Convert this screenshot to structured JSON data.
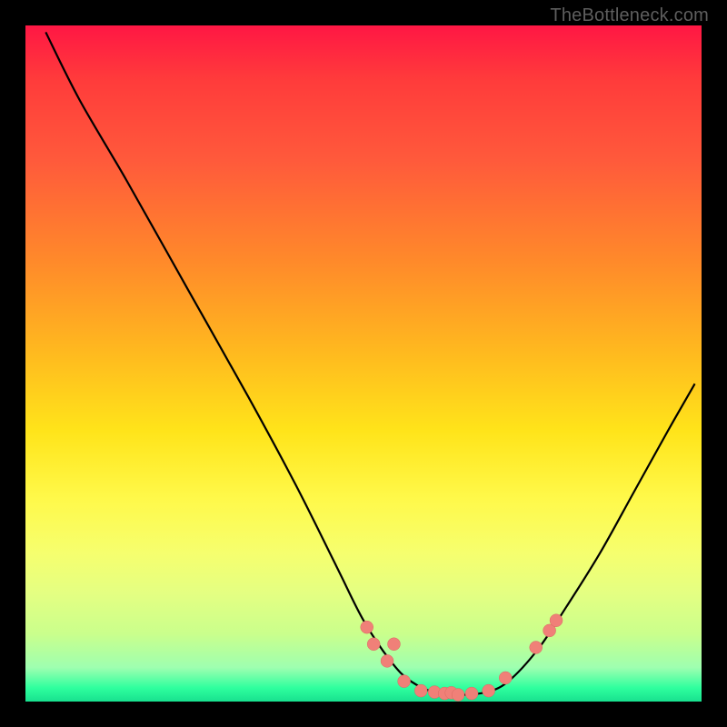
{
  "watermark": "TheBottleneck.com",
  "colors": {
    "curve_stroke": "#000000",
    "dot_fill": "#f08078",
    "dot_stroke": "#d86a62",
    "background_black": "#000000"
  },
  "chart_data": {
    "type": "line",
    "title": "",
    "xlabel": "",
    "ylabel": "",
    "xlim": [
      0,
      100
    ],
    "ylim": [
      0,
      100
    ],
    "left_curve": [
      {
        "x": 3,
        "y": 99
      },
      {
        "x": 8,
        "y": 89
      },
      {
        "x": 15,
        "y": 77
      },
      {
        "x": 24,
        "y": 61
      },
      {
        "x": 33,
        "y": 45
      },
      {
        "x": 40,
        "y": 32
      },
      {
        "x": 46,
        "y": 20
      },
      {
        "x": 50,
        "y": 12
      },
      {
        "x": 54,
        "y": 6
      },
      {
        "x": 57,
        "y": 3
      },
      {
        "x": 61,
        "y": 1.2
      },
      {
        "x": 65,
        "y": 1.0
      },
      {
        "x": 69,
        "y": 1.6
      },
      {
        "x": 72,
        "y": 3.5
      }
    ],
    "right_curve": [
      {
        "x": 72,
        "y": 3.5
      },
      {
        "x": 76,
        "y": 8
      },
      {
        "x": 80,
        "y": 14
      },
      {
        "x": 85,
        "y": 22
      },
      {
        "x": 90,
        "y": 31
      },
      {
        "x": 95,
        "y": 40
      },
      {
        "x": 99,
        "y": 47
      }
    ],
    "scatter_points": [
      {
        "x": 50.5,
        "y": 11.0
      },
      {
        "x": 51.5,
        "y": 8.5
      },
      {
        "x": 53.5,
        "y": 6.0
      },
      {
        "x": 54.5,
        "y": 8.5
      },
      {
        "x": 56.0,
        "y": 3.0
      },
      {
        "x": 58.5,
        "y": 1.6
      },
      {
        "x": 60.5,
        "y": 1.4
      },
      {
        "x": 62.0,
        "y": 1.2
      },
      {
        "x": 63.0,
        "y": 1.3
      },
      {
        "x": 64.0,
        "y": 1.0
      },
      {
        "x": 66.0,
        "y": 1.2
      },
      {
        "x": 68.5,
        "y": 1.6
      },
      {
        "x": 71.0,
        "y": 3.5
      },
      {
        "x": 75.5,
        "y": 8.0
      },
      {
        "x": 77.5,
        "y": 10.5
      },
      {
        "x": 78.5,
        "y": 12.0
      }
    ],
    "dot_radius_px": 7
  }
}
